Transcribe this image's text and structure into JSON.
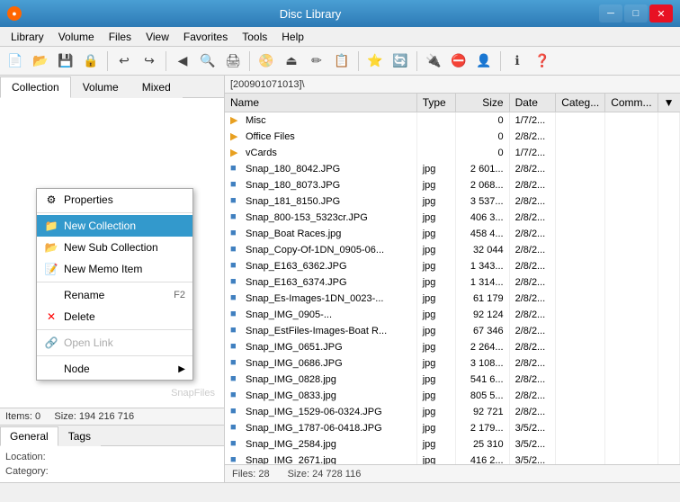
{
  "titleBar": {
    "title": "Disc Library",
    "minimizeLabel": "─",
    "maximizeLabel": "□",
    "closeLabel": "✕"
  },
  "menuBar": {
    "items": [
      "Library",
      "Volume",
      "Files",
      "View",
      "Favorites",
      "Tools",
      "Help"
    ]
  },
  "tabs": {
    "left": [
      "Collection",
      "Volume",
      "Mixed"
    ]
  },
  "path": "[200901071013]\\",
  "contextMenu": {
    "items": [
      {
        "id": "properties",
        "label": "Properties",
        "icon": "⚙",
        "shortcut": "",
        "disabled": false,
        "highlighted": false
      },
      {
        "id": "separator1"
      },
      {
        "id": "new-collection",
        "label": "New Collection",
        "icon": "📁",
        "shortcut": "",
        "disabled": false,
        "highlighted": true
      },
      {
        "id": "new-sub-collection",
        "label": "New Sub Collection",
        "icon": "📂",
        "shortcut": "",
        "disabled": false,
        "highlighted": false
      },
      {
        "id": "new-memo-item",
        "label": "New Memo Item",
        "icon": "📝",
        "shortcut": "",
        "disabled": false,
        "highlighted": false
      },
      {
        "id": "separator2"
      },
      {
        "id": "rename",
        "label": "Rename",
        "icon": "",
        "shortcut": "F2",
        "disabled": false,
        "highlighted": false
      },
      {
        "id": "delete",
        "label": "Delete",
        "icon": "✕",
        "shortcut": "",
        "disabled": false,
        "highlighted": false
      },
      {
        "id": "separator3"
      },
      {
        "id": "open-link",
        "label": "Open Link",
        "icon": "🔗",
        "shortcut": "",
        "disabled": true,
        "highlighted": false
      },
      {
        "id": "separator4"
      },
      {
        "id": "node",
        "label": "Node",
        "icon": "",
        "shortcut": "▶",
        "disabled": false,
        "highlighted": false
      }
    ]
  },
  "infoBar": {
    "items": "Items: 0",
    "size": "Size: 194 216 716"
  },
  "tagsTabs": [
    "General",
    "Tags"
  ],
  "tagsContent": {
    "location": "Location:",
    "category": "Category:"
  },
  "fileColumns": [
    "Name",
    "Type",
    "Size",
    "Date",
    "Categ...",
    "Comm..."
  ],
  "files": [
    {
      "name": "Misc",
      "type": "",
      "size": "0",
      "date": "1/7/2...",
      "categ": "",
      "comm": "",
      "isFolder": true
    },
    {
      "name": "Office Files",
      "type": "",
      "size": "0",
      "date": "2/8/2...",
      "categ": "",
      "comm": "",
      "isFolder": true
    },
    {
      "name": "vCards",
      "type": "",
      "size": "0",
      "date": "1/7/2...",
      "categ": "",
      "comm": "",
      "isFolder": true
    },
    {
      "name": "Snap_180_8042.JPG",
      "type": "jpg",
      "size": "2 601...",
      "date": "2/8/2...",
      "categ": "",
      "comm": "",
      "isFolder": false
    },
    {
      "name": "Snap_180_8073.JPG",
      "type": "jpg",
      "size": "2 068...",
      "date": "2/8/2...",
      "categ": "",
      "comm": "",
      "isFolder": false
    },
    {
      "name": "Snap_181_8150.JPG",
      "type": "jpg",
      "size": "3 537...",
      "date": "2/8/2...",
      "categ": "",
      "comm": "",
      "isFolder": false
    },
    {
      "name": "Snap_800-153_5323cr.JPG",
      "type": "jpg",
      "size": "406 3...",
      "date": "2/8/2...",
      "categ": "",
      "comm": "",
      "isFolder": false
    },
    {
      "name": "Snap_Boat Races.jpg",
      "type": "jpg",
      "size": "458 4...",
      "date": "2/8/2...",
      "categ": "",
      "comm": "",
      "isFolder": false
    },
    {
      "name": "Snap_Copy-Of-1DN_0905-06...",
      "type": "jpg",
      "size": "32 044",
      "date": "2/8/2...",
      "categ": "",
      "comm": "",
      "isFolder": false
    },
    {
      "name": "Snap_E163_6362.JPG",
      "type": "jpg",
      "size": "1 343...",
      "date": "2/8/2...",
      "categ": "",
      "comm": "",
      "isFolder": false
    },
    {
      "name": "Snap_E163_6374.JPG",
      "type": "jpg",
      "size": "1 314...",
      "date": "2/8/2...",
      "categ": "",
      "comm": "",
      "isFolder": false
    },
    {
      "name": "Snap_Es-Images-1DN_0023-...",
      "type": "jpg",
      "size": "61 179",
      "date": "2/8/2...",
      "categ": "",
      "comm": "",
      "isFolder": false
    },
    {
      "name": "Snap_IMG_0905-...",
      "type": "jpg",
      "size": "92 124",
      "date": "2/8/2...",
      "categ": "",
      "comm": "",
      "isFolder": false
    },
    {
      "name": "Snap_EstFiles-Images-Boat R...",
      "type": "jpg",
      "size": "67 346",
      "date": "2/8/2...",
      "categ": "",
      "comm": "",
      "isFolder": false
    },
    {
      "name": "Snap_IMG_0651.JPG",
      "type": "jpg",
      "size": "2 264...",
      "date": "2/8/2...",
      "categ": "",
      "comm": "",
      "isFolder": false
    },
    {
      "name": "Snap_IMG_0686.JPG",
      "type": "jpg",
      "size": "3 108...",
      "date": "2/8/2...",
      "categ": "",
      "comm": "",
      "isFolder": false
    },
    {
      "name": "Snap_IMG_0828.jpg",
      "type": "jpg",
      "size": "541 6...",
      "date": "2/8/2...",
      "categ": "",
      "comm": "",
      "isFolder": false
    },
    {
      "name": "Snap_IMG_0833.jpg",
      "type": "jpg",
      "size": "805 5...",
      "date": "2/8/2...",
      "categ": "",
      "comm": "",
      "isFolder": false
    },
    {
      "name": "Snap_IMG_1529-06-0324.JPG",
      "type": "jpg",
      "size": "92 721",
      "date": "2/8/2...",
      "categ": "",
      "comm": "",
      "isFolder": false
    },
    {
      "name": "Snap_IMG_1787-06-0418.JPG",
      "type": "jpg",
      "size": "2 179...",
      "date": "3/5/2...",
      "categ": "",
      "comm": "",
      "isFolder": false
    },
    {
      "name": "Snap_IMG_2584.jpg",
      "type": "jpg",
      "size": "25 310",
      "date": "3/5/2...",
      "categ": "",
      "comm": "",
      "isFolder": false
    },
    {
      "name": "Snap_IMG_2671.jpg",
      "type": "jpg",
      "size": "416 2...",
      "date": "3/5/2...",
      "categ": "",
      "comm": "",
      "isFolder": false
    }
  ],
  "filesStatusBar": {
    "count": "Files: 28",
    "size": "Size: 24 728 116"
  },
  "statusBar": {
    "text": ""
  },
  "leftPanelLabel": "Collection"
}
